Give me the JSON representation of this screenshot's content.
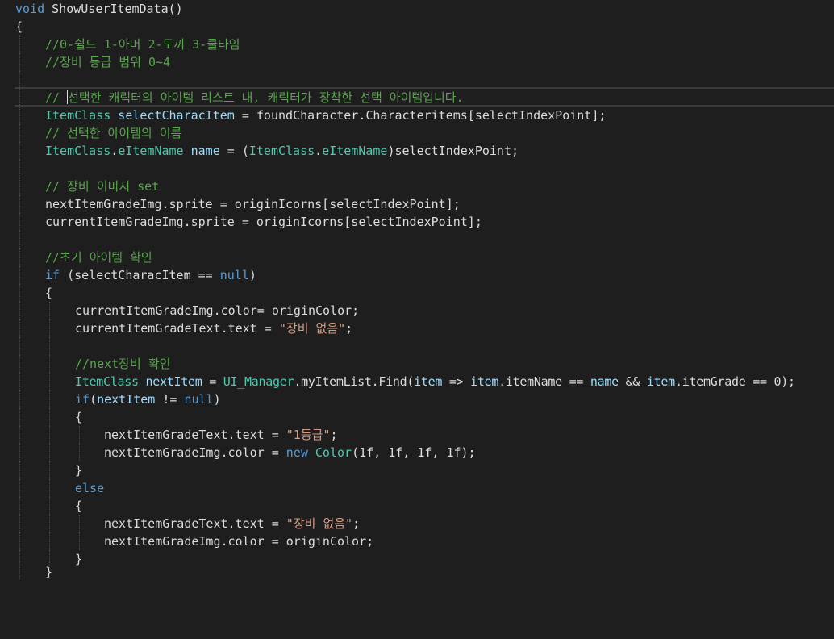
{
  "colors": {
    "background": "#1e1e1e",
    "keyword": "#569cd6",
    "comment": "#57a64a",
    "type": "#4ec9b0",
    "string": "#d69d85",
    "identifier": "#9cdcfe",
    "plain": "#dcdcdc"
  },
  "code": {
    "l1": {
      "a": "void",
      "b": " ShowUserItemData()"
    },
    "l2": "{",
    "l3": "//0-쉴드 1-아머 2-도끼 3-쿨타임",
    "l4": "//장비 등급 범위 0~4",
    "l6": {
      "a": "// ",
      "b": "선택한 캐릭터의 아이템 리스트 내, 캐릭터가 장착한 선택 아이템입니다."
    },
    "l7": {
      "a": "ItemClass",
      "b": " selectCharacItem",
      "c": " = foundCharacter.Characteritems[selectIndexPoint];"
    },
    "l8": "// 선택한 아이템의 이름",
    "l9": {
      "a": "ItemClass",
      "b": ".",
      "c": "eItemName",
      "d": " name",
      "e": " = (",
      "f": "ItemClass",
      "g": ".",
      "h": "eItemName",
      "i": ")selectIndexPoint;"
    },
    "l11": "// 장비 이미지 set",
    "l12": "nextItemGradeImg.sprite = originIcorns[selectIndexPoint];",
    "l13": "currentItemGradeImg.sprite = originIcorns[selectIndexPoint];",
    "l15": "//초기 아이템 확인",
    "l16": {
      "a": "if",
      "b": " (selectCharacItem == ",
      "c": "null",
      "d": ")"
    },
    "l17": "{",
    "l18": "currentItemGradeImg.color= originColor;",
    "l19": {
      "a": "currentItemGradeText.text = ",
      "b": "\"장비 없음\"",
      "c": ";"
    },
    "l21": "//next장비 확인",
    "l22": {
      "a": "ItemClass",
      "b": " nextItem",
      "c": " = ",
      "d": "UI_Manager",
      "e": ".myItemList.Find(",
      "f": "item",
      "g": " => ",
      "h": "item",
      "i": ".itemName == ",
      "j": "name",
      "k": " && ",
      "l": "item",
      "m": ".itemGrade == 0);"
    },
    "l23": {
      "a": "if",
      "b": "(",
      "c": "nextItem",
      "d": " != ",
      "e": "null",
      "f": ")"
    },
    "l24": "{",
    "l25": {
      "a": "nextItemGradeText.text = ",
      "b": "\"1등급\"",
      "c": ";"
    },
    "l26": {
      "a": "nextItemGradeImg.color = ",
      "b": "new",
      "c": " ",
      "d": "Color",
      "e": "(1f, 1f, 1f, 1f);"
    },
    "l27": "}",
    "l28": "else",
    "l29": "{",
    "l30": {
      "a": "nextItemGradeText.text = ",
      "b": "\"장비 없음\"",
      "c": ";"
    },
    "l31": "nextItemGradeImg.color = originColor;",
    "l32": "}",
    "l33": "}"
  }
}
